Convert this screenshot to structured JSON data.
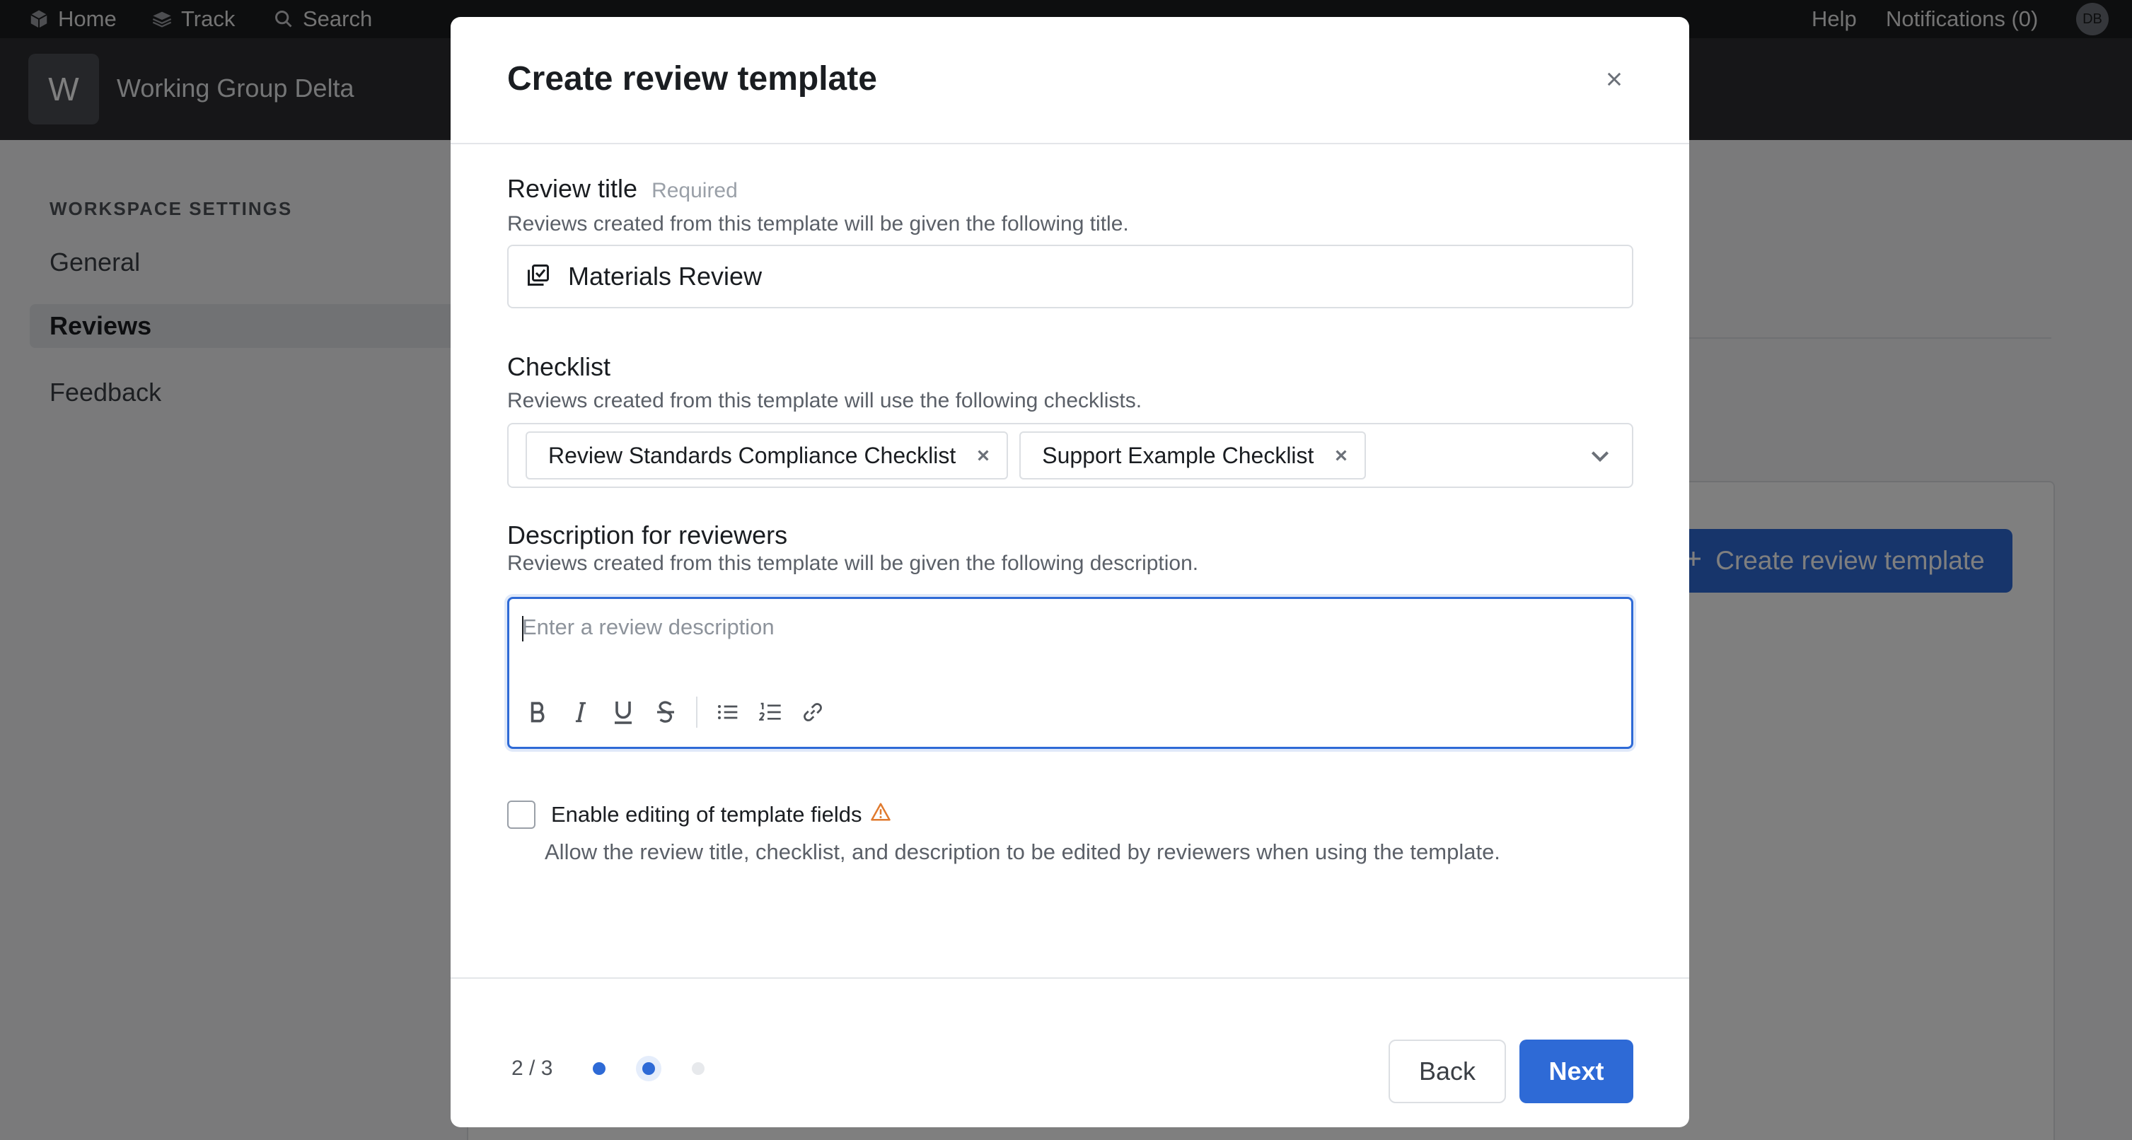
{
  "topnav": {
    "home": "Home",
    "track": "Track",
    "search": "Search",
    "help": "Help",
    "notifications": "Notifications (0)",
    "avatar_initials": "DB"
  },
  "workspace": {
    "logo_letter": "W",
    "name": "Working Group Delta"
  },
  "sidebar": {
    "heading": "WORKSPACE SETTINGS",
    "items": [
      {
        "label": "General",
        "active": false
      },
      {
        "label": "Reviews",
        "active": true
      },
      {
        "label": "Feedback",
        "active": false
      }
    ]
  },
  "background": {
    "create_button": "Create review template"
  },
  "modal": {
    "title": "Create review template",
    "review_title": {
      "label": "Review title",
      "required": "Required",
      "help": "Reviews created from this template will be given the following title.",
      "value": "Materials Review"
    },
    "checklist": {
      "label": "Checklist",
      "help": "Reviews created from this template will use the following checklists.",
      "selected": [
        "Review Standards Compliance Checklist",
        "Support Example Checklist"
      ]
    },
    "description": {
      "label": "Description for reviewers",
      "help": "Reviews created from this template will be given the following description.",
      "placeholder": "Enter a review description",
      "value": ""
    },
    "enable_editing": {
      "label": "Enable editing of template fields",
      "checked": false,
      "help": "Allow the review title, checklist, and description to be edited by reviewers when using the template."
    },
    "footer": {
      "step": "2 / 3",
      "current_step": 2,
      "total_steps": 3,
      "back": "Back",
      "next": "Next"
    }
  },
  "colors": {
    "accent": "#2e6ad6",
    "warning": "#e07a2e",
    "topnav_bg": "#1b1c1e",
    "workspace_bar_bg": "#2c2d30"
  }
}
